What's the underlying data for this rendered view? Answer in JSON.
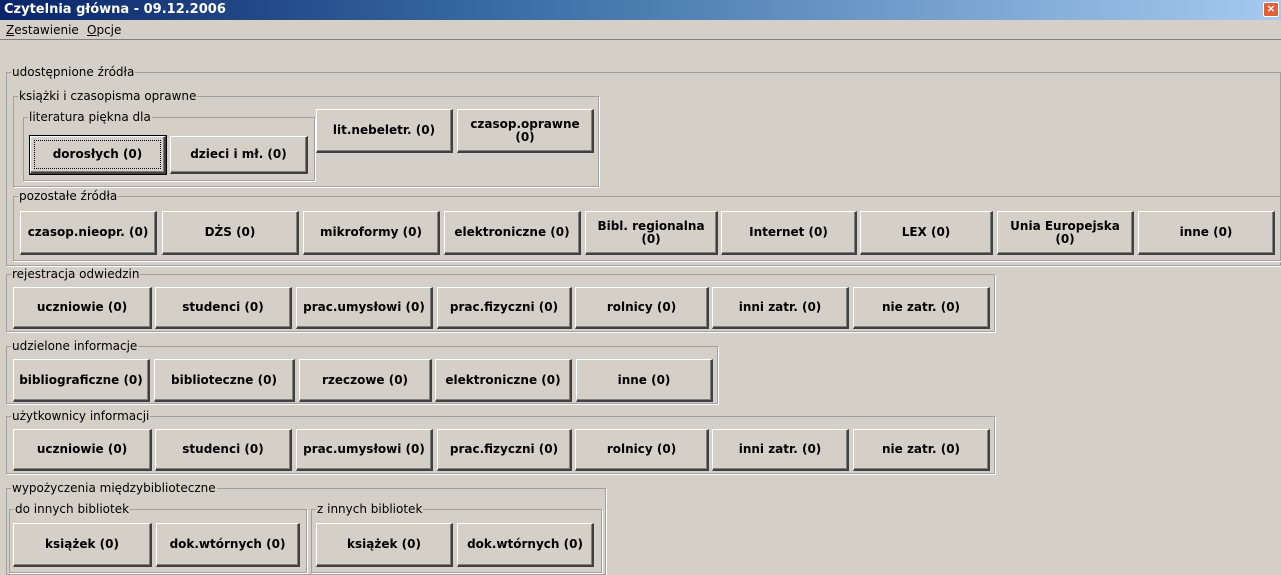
{
  "window": {
    "title": "Czytelnia główna - 09.12.2006",
    "close": "×"
  },
  "menu": {
    "zestawienie": {
      "first": "Z",
      "rest": "estawienie"
    },
    "opcje": {
      "first": "O",
      "rest": "pcje"
    }
  },
  "udostepnione": {
    "legend": "udostępnione źródła",
    "ksiazki": {
      "legend": "książki i czasopisma oprawne",
      "literatura": {
        "legend": "literatura piękna dla",
        "doroslych": "dorosłych (0)",
        "dzieci": "dzieci i mł. (0)"
      },
      "nebeletr": "lit.nebeletr. (0)",
      "czasop_oprawne": "czasop.oprawne (0)"
    },
    "pozostale": {
      "legend": "pozostałe źródła",
      "buttons": [
        "czasop.nieopr. (0)",
        "DŻS (0)",
        "mikroformy (0)",
        "elektroniczne (0)",
        "Bibl. regionalna (0)",
        "Internet (0)",
        "LEX (0)",
        "Unia Europejska (0)",
        "inne (0)"
      ]
    }
  },
  "rejestracja": {
    "legend": "rejestracja odwiedzin",
    "buttons": [
      "uczniowie (0)",
      "studenci (0)",
      "prac.umysłowi (0)",
      "prac.fizyczni (0)",
      "rolnicy (0)",
      "inni zatr. (0)",
      "nie zatr. (0)"
    ]
  },
  "udzielone": {
    "legend": "udzielone informacje",
    "buttons": [
      "bibliograficzne (0)",
      "biblioteczne (0)",
      "rzeczowe (0)",
      "elektroniczne (0)",
      "inne (0)"
    ]
  },
  "uzytkownicy": {
    "legend": "użytkownicy informacji",
    "buttons": [
      "uczniowie (0)",
      "studenci (0)",
      "prac.umysłowi (0)",
      "prac.fizyczni (0)",
      "rolnicy (0)",
      "inni zatr. (0)",
      "nie zatr. (0)"
    ]
  },
  "wypozyczenia": {
    "legend": "wypożyczenia międzybiblioteczne",
    "do_innych": {
      "legend": "do innych bibliotek",
      "ksiazek": "książek (0)",
      "dok": "dok.wtórnych (0)"
    },
    "z_innych": {
      "legend": "z innych bibliotek",
      "ksiazek": "książek (0)",
      "dok": "dok.wtórnych (0)"
    }
  }
}
